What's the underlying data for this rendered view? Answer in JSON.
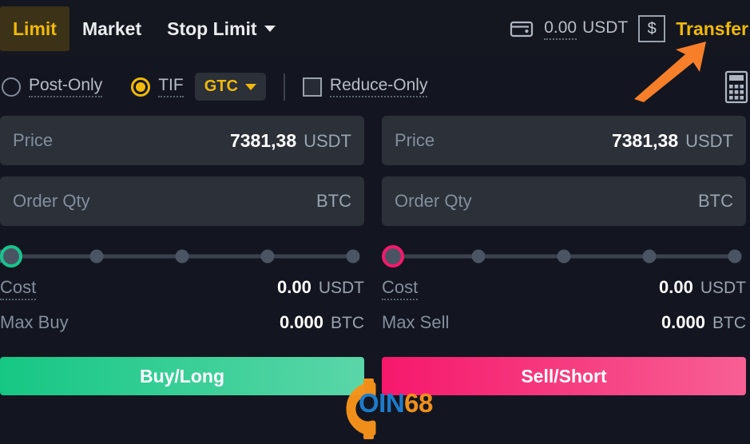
{
  "order_tabs": [
    {
      "label": "Limit",
      "active": true
    },
    {
      "label": "Market",
      "active": false
    },
    {
      "label": "Stop Limit",
      "active": false,
      "caret": true
    }
  ],
  "header": {
    "wallet_icon": "wallet-icon",
    "balance_amount": "0.00",
    "balance_currency": "USDT",
    "currency_toggle": "$",
    "transfer_label": "Transfer"
  },
  "options": {
    "post_only": {
      "label": "Post-Only",
      "checked": false
    },
    "tif": {
      "label": "TIF",
      "checked": true
    },
    "tif_value": "GTC",
    "reduce_only": {
      "label": "Reduce-Only",
      "checked": false
    },
    "calculator_icon": "calculator-icon"
  },
  "buy_panel": {
    "price": {
      "label": "Price",
      "value": "7381,38",
      "unit": "USDT"
    },
    "qty": {
      "placeholder": "Order Qty",
      "value": "",
      "unit": "BTC"
    },
    "slider": {
      "position_percent": 0,
      "marks": [
        0,
        25,
        50,
        75,
        100
      ],
      "accent": "#18c48f"
    },
    "cost": {
      "label": "Cost",
      "value": "0.00",
      "unit": "USDT"
    },
    "max": {
      "label": "Max Buy",
      "value": "0.000",
      "unit": "BTC"
    },
    "action_label": "Buy/Long",
    "action_color": "#16c784"
  },
  "sell_panel": {
    "price": {
      "label": "Price",
      "value": "7381,38",
      "unit": "USDT"
    },
    "qty": {
      "placeholder": "Order Qty",
      "value": "",
      "unit": "BTC"
    },
    "slider": {
      "position_percent": 0,
      "marks": [
        0,
        25,
        50,
        75,
        100
      ],
      "accent": "#f6186c"
    },
    "cost": {
      "label": "Cost",
      "value": "0.00",
      "unit": "USDT"
    },
    "max": {
      "label": "Max Sell",
      "value": "0.000",
      "unit": "BTC"
    },
    "action_label": "Sell/Short",
    "action_color": "#f6186c"
  },
  "annotations": {
    "arrow": {
      "color": "#f77f2a",
      "points_to": "transfer-link"
    }
  },
  "watermark": {
    "text_primary": "OIN",
    "text_secondary": "68",
    "color_gear": "#f7931a",
    "color_text": "#1f7fd0"
  },
  "theme": {
    "background": "#131620",
    "panel_field": "#2b3039",
    "accent_gold": "#f0b90b",
    "accent_green": "#16c784",
    "accent_pink": "#f6186c"
  }
}
